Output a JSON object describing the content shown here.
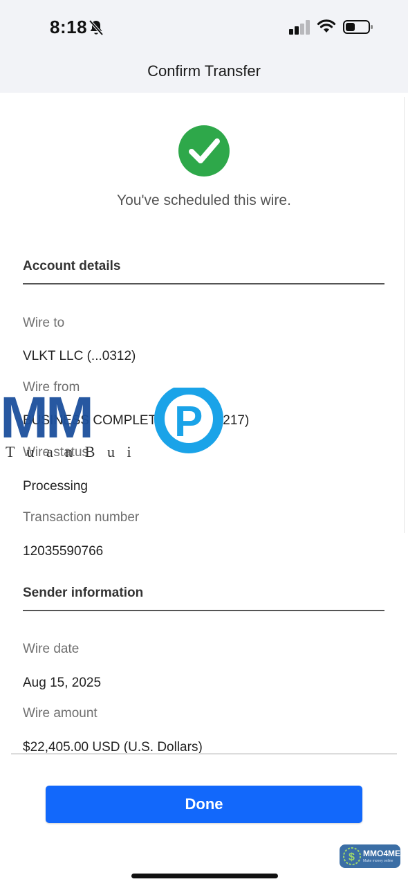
{
  "status_bar": {
    "time": "8:18",
    "icons": [
      "bell-slash-icon",
      "cellular-signal-icon",
      "wifi-icon",
      "battery-icon"
    ]
  },
  "nav": {
    "title": "Confirm Transfer"
  },
  "success": {
    "message": "You've scheduled this wire.",
    "icon": "check-circle-icon",
    "color": "#2ea84a"
  },
  "account_details": {
    "title": "Account details",
    "wire_to_label": "Wire to",
    "wire_to_value": "VLKT LLC (...0312)",
    "wire_from_label": "Wire from",
    "wire_from_value": "BUSINESS COMPLETE CHK (...6217)",
    "wire_status_label": "Wire status",
    "wire_status_value": "Processing",
    "transaction_label": "Transaction number",
    "transaction_value": "12035590766"
  },
  "sender_information": {
    "title": "Sender information",
    "wire_date_label": "Wire date",
    "wire_date_value": "Aug 15, 2025",
    "wire_amount_label": "Wire amount",
    "wire_amount_value": "$22,405.00 USD (U.S. Dollars)"
  },
  "watermark": {
    "logo": "MMO",
    "subtitle": "T u a n   B u i"
  },
  "done_button": {
    "label": "Done",
    "color": "#1268fb"
  },
  "badge": {
    "title": "MMO4ME",
    "subtitle": "Make money online"
  }
}
